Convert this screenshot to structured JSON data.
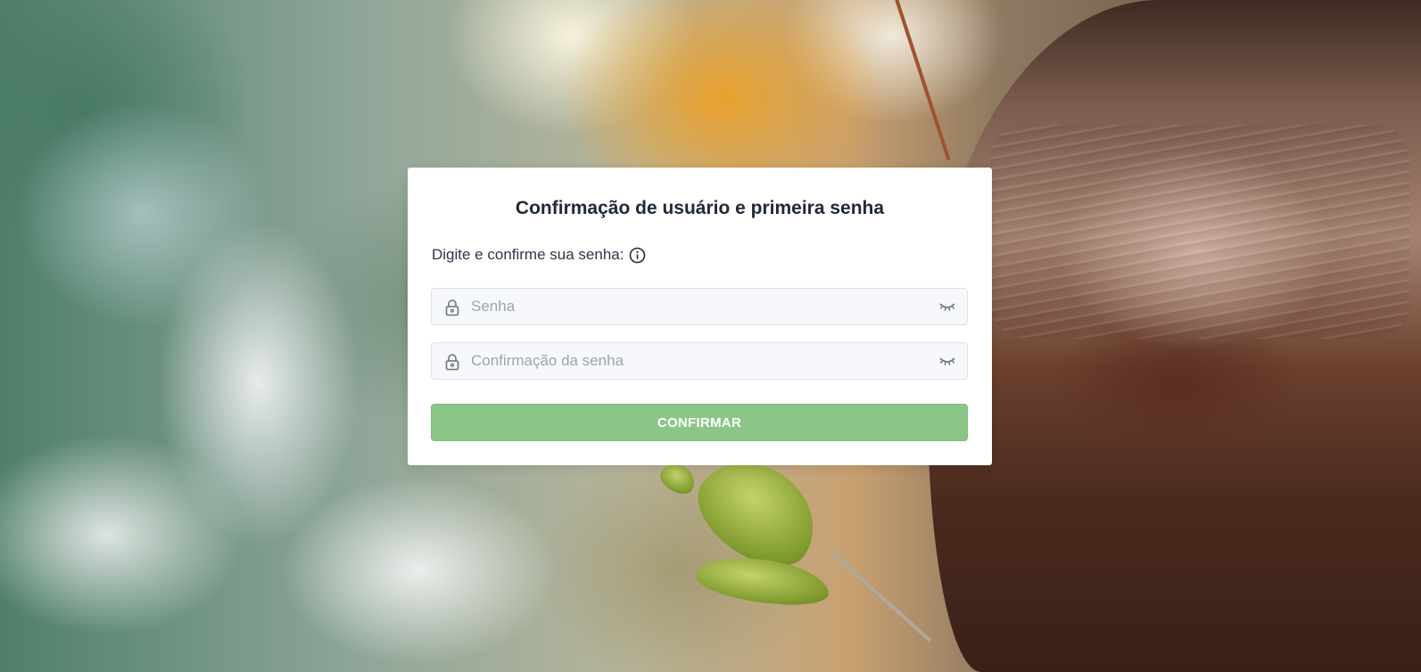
{
  "form": {
    "title": "Confirmação de usuário e primeira senha",
    "prompt": "Digite e confirme sua senha:",
    "password": {
      "placeholder": "Senha",
      "value": "",
      "icon": "lock-icon",
      "toggle_icon": "eye-closed-icon"
    },
    "password_confirmation": {
      "placeholder": "Confirmação da senha",
      "value": "",
      "icon": "lock-icon",
      "toggle_icon": "eye-closed-icon"
    },
    "confirm_label": "CONFIRMAR",
    "info_icon": "info-icon"
  },
  "colors": {
    "button": "#8bc687",
    "title": "#1f2937",
    "field_background": "#f7f8fb",
    "placeholder": "#9aa3b2"
  }
}
